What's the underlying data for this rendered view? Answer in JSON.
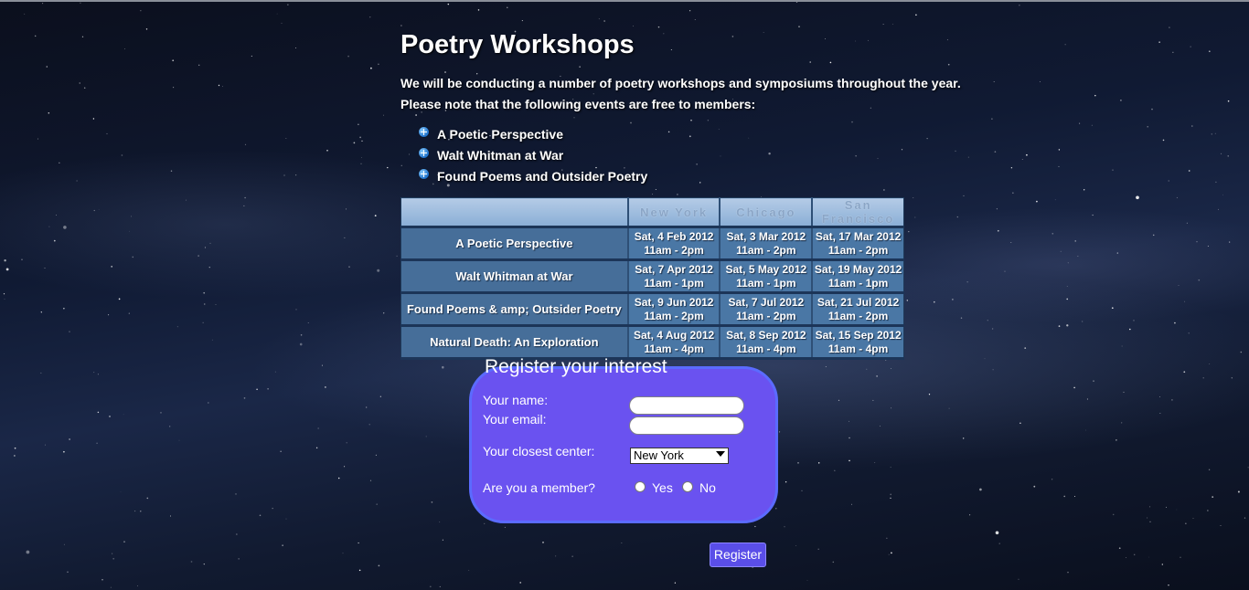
{
  "page": {
    "title": "Poetry Workshops",
    "intro_line1": "We will be conducting a number of poetry workshops and symposiums throughout the year.",
    "intro_line2": "Please note that the following events are free to members:"
  },
  "bullets": [
    "A Poetic Perspective",
    "Walt Whitman at War",
    "Found Poems and Outsider Poetry"
  ],
  "schedule": {
    "headers": [
      "",
      "New York",
      "Chicago",
      "San Francisco"
    ],
    "rows": [
      {
        "event": "A Poetic Perspective",
        "dates": [
          {
            "date": "Sat, 4 Feb 2012",
            "time": "11am - 2pm"
          },
          {
            "date": "Sat, 3 Mar 2012",
            "time": "11am - 2pm"
          },
          {
            "date": "Sat, 17 Mar 2012",
            "time": "11am - 2pm"
          }
        ]
      },
      {
        "event": "Walt Whitman at War",
        "dates": [
          {
            "date": "Sat, 7 Apr 2012",
            "time": "11am - 1pm"
          },
          {
            "date": "Sat, 5 May 2012",
            "time": "11am - 1pm"
          },
          {
            "date": "Sat, 19 May 2012",
            "time": "11am - 1pm"
          }
        ]
      },
      {
        "event": "Found Poems & amp; Outsider Poetry",
        "dates": [
          {
            "date": "Sat, 9 Jun 2012",
            "time": "11am - 2pm"
          },
          {
            "date": "Sat, 7 Jul 2012",
            "time": "11am - 2pm"
          },
          {
            "date": "Sat, 21 Jul 2012",
            "time": "11am - 2pm"
          }
        ]
      },
      {
        "event": "Natural Death: An Exploration",
        "dates": [
          {
            "date": "Sat, 4 Aug 2012",
            "time": "11am - 4pm"
          },
          {
            "date": "Sat, 8 Sep 2012",
            "time": "11am - 4pm"
          },
          {
            "date": "Sat, 15 Sep 2012",
            "time": "11am - 4pm"
          }
        ]
      }
    ]
  },
  "form": {
    "legend": "Register your interest",
    "name_label": "Your name:",
    "name_value": "",
    "email_label": "Your email:",
    "email_value": "",
    "center_label": "Your closest center:",
    "center_selected": "New York",
    "member_label": "Are you a member?",
    "yes_label": "Yes",
    "no_label": "No",
    "submit_label": "Register"
  },
  "colors": {
    "panel": "#6a52f0",
    "button": "#5a4ee8",
    "table_cell": "#4a77a5",
    "table_header": "#8aaed6"
  }
}
